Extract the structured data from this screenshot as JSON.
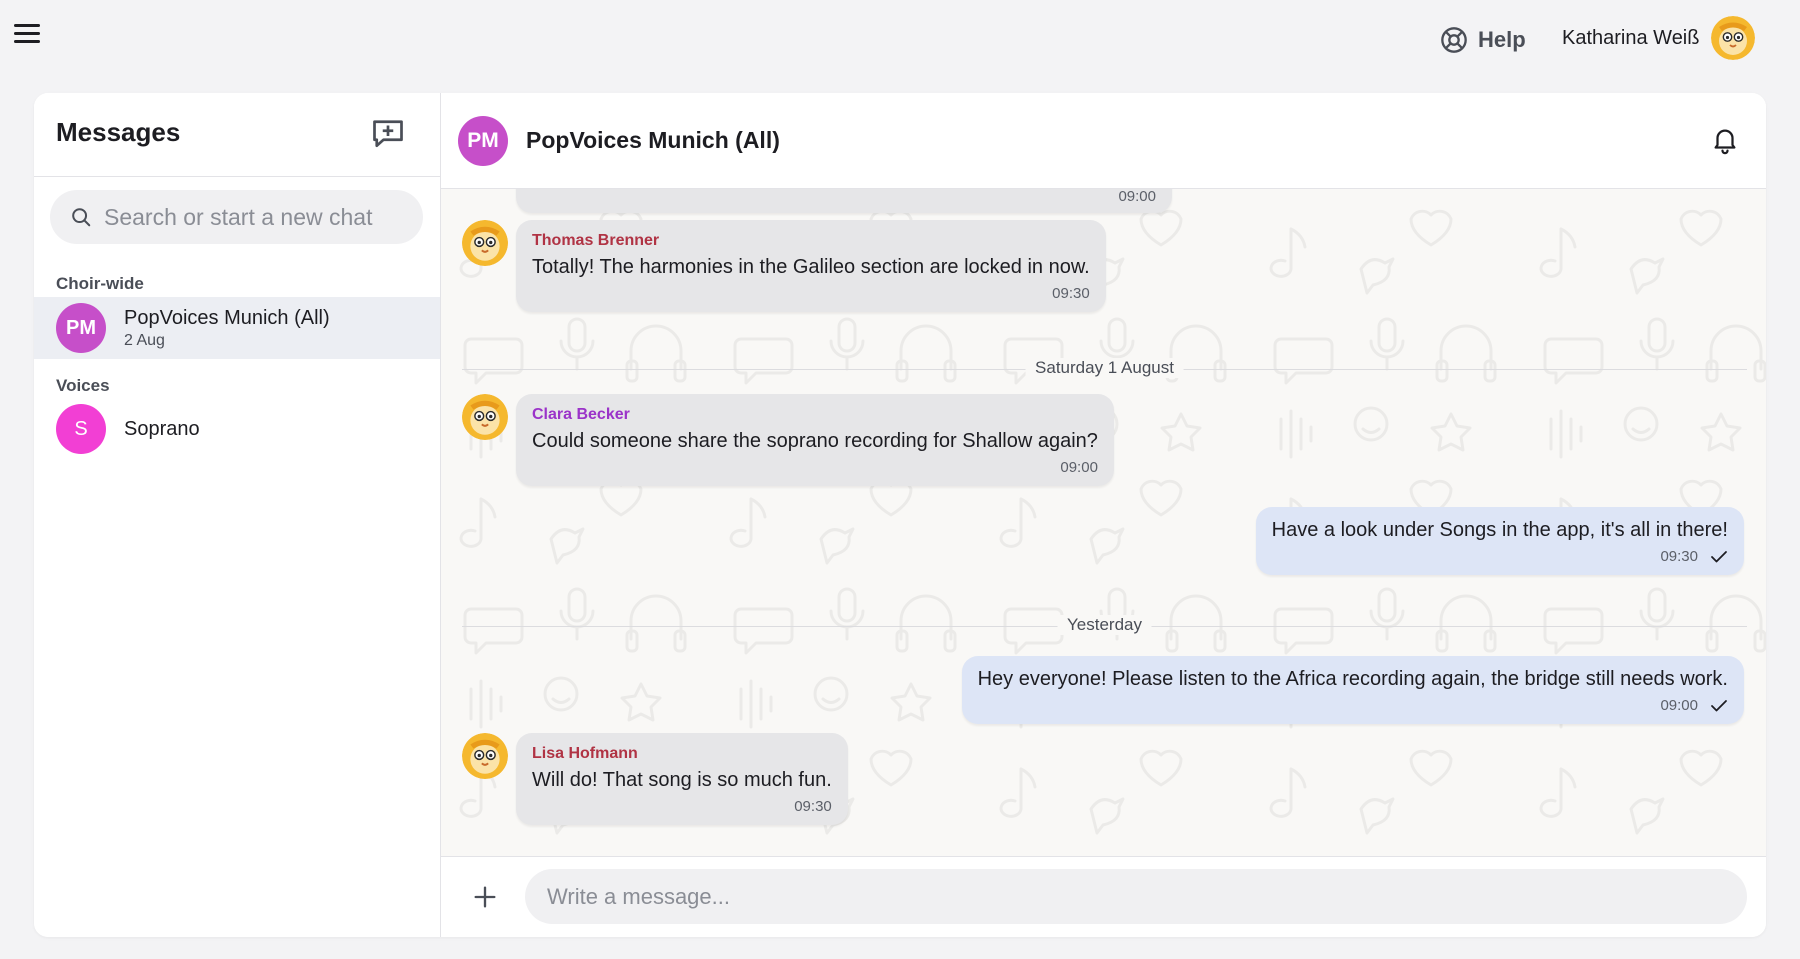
{
  "topbar": {
    "help_label": "Help",
    "user_name": "Katharina Weiß"
  },
  "sidebar": {
    "title": "Messages",
    "search_placeholder": "Search or start a new chat",
    "groups": [
      {
        "label": "Choir-wide",
        "chats": [
          {
            "initials": "PM",
            "name": "PopVoices Munich (All)",
            "date": "2 Aug",
            "color": "#c64fc9",
            "active": true
          }
        ]
      },
      {
        "label": "Voices",
        "chats": [
          {
            "initials": "S",
            "name": "Soprano",
            "date": "",
            "color": "#f23fd4",
            "active": false
          }
        ]
      }
    ]
  },
  "chat": {
    "header": {
      "initials": "PM",
      "title": "PopVoices Munich (All)",
      "color": "#c64fc9"
    },
    "messages": [
      {
        "type": "in",
        "sender": "",
        "text": "",
        "time": "09:00"
      },
      {
        "type": "in",
        "sender": "Thomas Brenner",
        "sender_color": "#b03344",
        "text": "Totally! The harmonies in the Galileo section are locked in now.",
        "time": "09:30"
      },
      {
        "type": "divider",
        "label": "Saturday 1 August"
      },
      {
        "type": "in",
        "sender": "Clara Becker",
        "sender_color": "#9b33c9",
        "text": "Could someone share the soprano recording for Shallow again?",
        "time": "09:00"
      },
      {
        "type": "out",
        "text": "Have a look under Songs in the app, it's all in there!",
        "time": "09:30"
      },
      {
        "type": "divider",
        "label": "Yesterday"
      },
      {
        "type": "out",
        "text": "Hey everyone! Please listen to the Africa recording again, the bridge still needs work.",
        "time": "09:00"
      },
      {
        "type": "in",
        "sender": "Lisa Hofmann",
        "sender_color": "#b03344",
        "text": "Will do! That song is so much fun.",
        "time": "09:30"
      }
    ],
    "composer_placeholder": "Write a message..."
  }
}
